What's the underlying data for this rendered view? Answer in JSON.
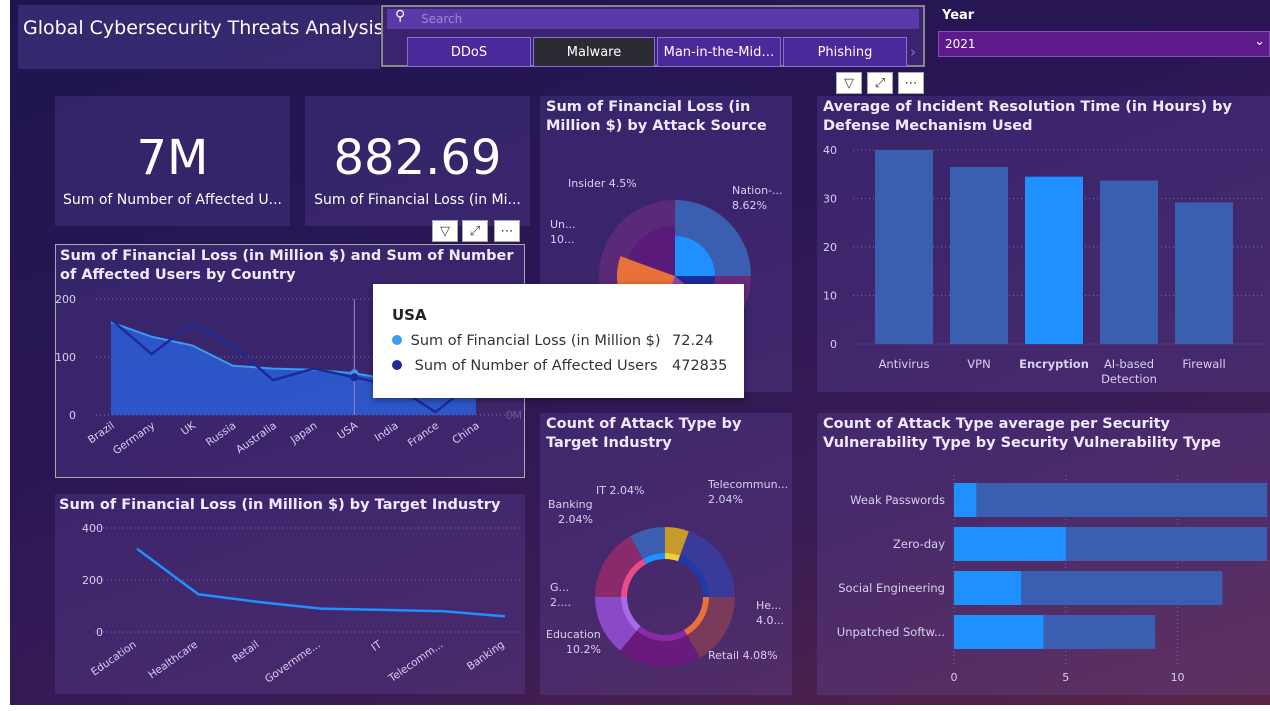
{
  "header": {
    "title": "Global Cybersecurity Threats Analysis"
  },
  "slicer": {
    "search_placeholder": "Search",
    "options": [
      {
        "label": "DDoS",
        "selected": false
      },
      {
        "label": "Malware",
        "selected": true
      },
      {
        "label": "Man-in-the-Mid…",
        "selected": false
      },
      {
        "label": "Phishing",
        "selected": false
      }
    ]
  },
  "year_filter": {
    "label": "Year",
    "value": "2021"
  },
  "kpis": [
    {
      "value": "7M",
      "label": "Sum of Number of Affected U..."
    },
    {
      "value": "882.69",
      "label": "Sum of Financial Loss (in Mi..."
    }
  ],
  "tooltip": {
    "title": "USA",
    "rows": [
      {
        "label": "Sum of Financial Loss (in Million $)",
        "value": "72.24",
        "color": "#3a9bf0"
      },
      {
        "label": "Sum of Number of Affected Users",
        "value": "472835",
        "color": "#1c2a9a"
      }
    ]
  },
  "chart_data": [
    {
      "id": "country",
      "type": "area",
      "title": "Sum of Financial Loss (in Million $) and Sum of Number of Affected Users by Country",
      "categories": [
        "Brazil",
        "Germany",
        "UK",
        "Russia",
        "Australia",
        "Japan",
        "USA",
        "India",
        "France",
        "China"
      ],
      "series": [
        {
          "name": "Sum of Financial Loss (in Million $)",
          "values": [
            160,
            135,
            120,
            85,
            80,
            78,
            72,
            60,
            40,
            75
          ]
        },
        {
          "name": "Sum of Number of Affected Users",
          "values": [
            165,
            105,
            158,
            120,
            60,
            80,
            65,
            50,
            5,
            60
          ]
        }
      ],
      "yticks": [
        "0",
        "100",
        "200"
      ],
      "y2label": "0M",
      "ylim": [
        0,
        200
      ],
      "highlight_category": "USA"
    },
    {
      "id": "industry_line",
      "type": "line",
      "title": "Sum of Financial Loss (in Million $) by Target Industry",
      "categories": [
        "Education",
        "Healthcare",
        "Retail",
        "Governme...",
        "IT",
        "Telecomm...",
        "Banking"
      ],
      "values": [
        320,
        145,
        115,
        90,
        85,
        80,
        60
      ],
      "yticks": [
        "0",
        "200",
        "400"
      ],
      "ylim": [
        0,
        400
      ]
    },
    {
      "id": "attack_source",
      "type": "pie",
      "title": "Sum of Financial Loss (in Million $) by Attack Source",
      "labels": [
        {
          "name": "Insider",
          "pct": "4.5%"
        },
        {
          "name": "Nation-...",
          "pct": "8.62%"
        },
        {
          "name": "Un...",
          "pct": "10..."
        }
      ]
    },
    {
      "id": "resolution",
      "type": "bar",
      "title": "Average of Incident Resolution Time (in Hours) by Defense Mechanism Used",
      "categories": [
        "Antivirus",
        "VPN",
        "Encryption",
        "AI-based Detection",
        "Firewall"
      ],
      "values": [
        40,
        36.5,
        34.5,
        33.7,
        29.2
      ],
      "highlight": "Encryption",
      "yticks": [
        "0",
        "10",
        "20",
        "30",
        "40"
      ],
      "ylim": [
        0,
        40
      ]
    },
    {
      "id": "attack_industry",
      "type": "pie",
      "title": "Count of Attack Type by Target Industry",
      "labels": [
        {
          "name": "IT",
          "pct": "2.04%"
        },
        {
          "name": "Telecommun...",
          "pct": "2.04%"
        },
        {
          "name": "Banking",
          "pct": "2.04%"
        },
        {
          "name": "G...",
          "pct": "2...."
        },
        {
          "name": "He...",
          "pct": "4.0..."
        },
        {
          "name": "Education",
          "pct": "10.2%"
        },
        {
          "name": "Retail",
          "pct": "4.08%"
        }
      ]
    },
    {
      "id": "vulnerability",
      "type": "bar",
      "title": "Count of Attack Type average per Security Vulnerability Type by Security Vulnerability Type",
      "categories": [
        "Weak Passwords",
        "Zero-day",
        "Social Engineering",
        "Unpatched Softw..."
      ],
      "values": [
        1,
        5,
        3,
        4
      ],
      "totals": [
        14,
        14,
        12,
        9
      ],
      "xticks": [
        "0",
        "5",
        "10"
      ],
      "xlim": [
        0,
        14
      ]
    }
  ],
  "colors": {
    "accent": "#1e90ff",
    "bar": "#3a5fb0",
    "slicer": "#4a2a9a",
    "bg": "#241650"
  }
}
